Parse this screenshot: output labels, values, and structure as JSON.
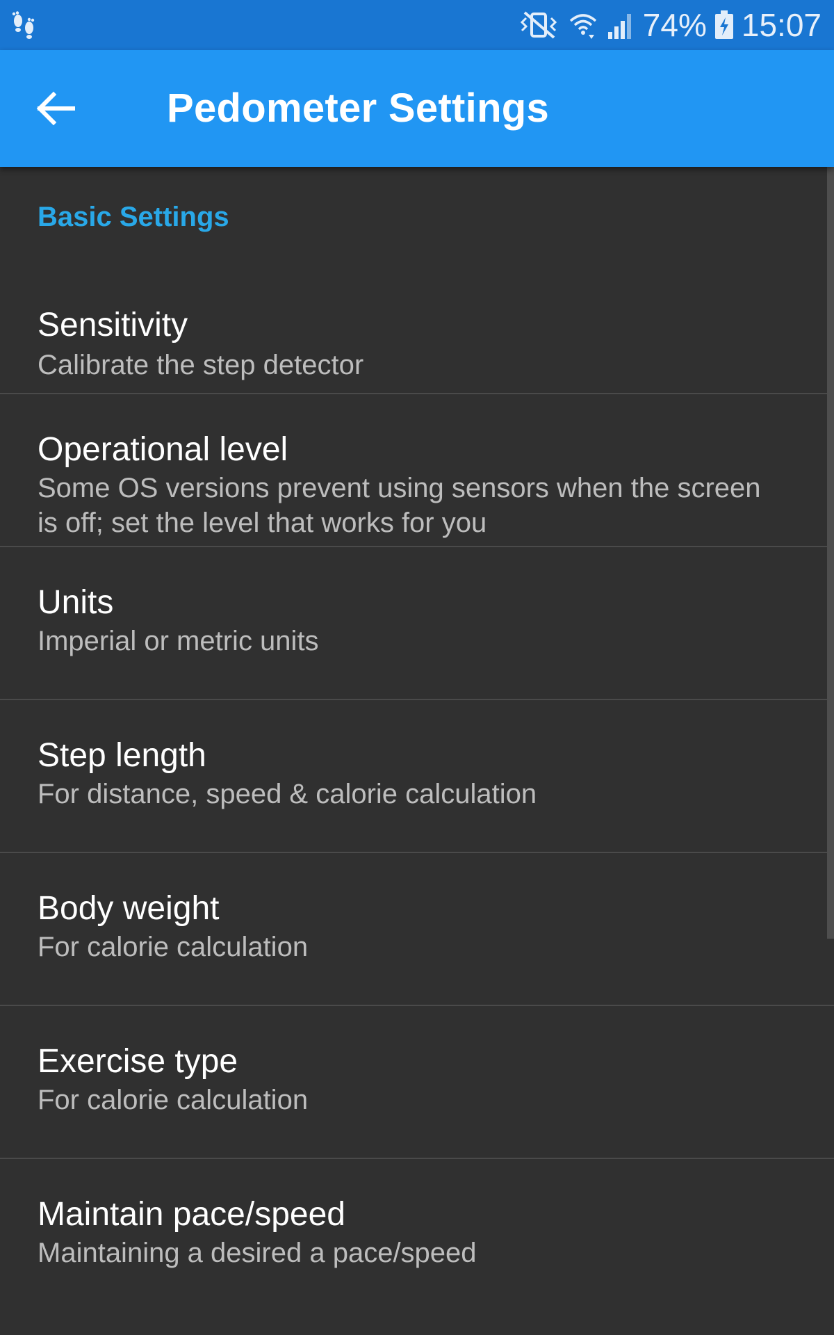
{
  "status_bar": {
    "battery_percent": "74%",
    "time": "15:07"
  },
  "app_bar": {
    "title": "Pedometer Settings"
  },
  "section": {
    "header": "Basic Settings"
  },
  "preferences": [
    {
      "title": "Sensitivity",
      "summary": "Calibrate the step detector"
    },
    {
      "title": "Operational level",
      "summary": "Some OS versions prevent using sensors when the screen is off; set the level that works for you"
    },
    {
      "title": "Units",
      "summary": "Imperial or metric units"
    },
    {
      "title": "Step length",
      "summary": "For distance, speed & calorie calculation"
    },
    {
      "title": "Body weight",
      "summary": "For calorie calculation"
    },
    {
      "title": "Exercise type",
      "summary": "For calorie calculation"
    },
    {
      "title": "Maintain pace/speed",
      "summary": "Maintaining a desired a pace/speed"
    }
  ],
  "colors": {
    "status_bar": "#1976D2",
    "app_bar": "#2196F3",
    "background": "#303030",
    "section_header": "#29A8E8",
    "summary_text": "#BDBDBD"
  },
  "icons": [
    "footprints-icon",
    "vibrate-mute-icon",
    "wifi-icon",
    "cell-signal-icon",
    "battery-charging-icon",
    "arrow-back-icon"
  ]
}
